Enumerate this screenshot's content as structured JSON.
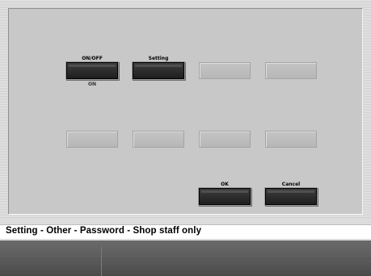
{
  "grid": {
    "row1": [
      {
        "label": "ON/OFF",
        "sub": "ON",
        "enabled": true
      },
      {
        "label": "Setting",
        "sub": "",
        "enabled": true
      },
      {
        "label": "",
        "sub": "",
        "enabled": false
      },
      {
        "label": "",
        "sub": "",
        "enabled": false
      }
    ],
    "row2": [
      {
        "label": "",
        "enabled": false
      },
      {
        "label": "",
        "enabled": false
      },
      {
        "label": "",
        "enabled": false
      },
      {
        "label": "",
        "enabled": false
      }
    ]
  },
  "actions": {
    "ok_label": "OK",
    "cancel_label": "Cancel"
  },
  "status": {
    "text": "Setting - Other - Password - Shop staff only"
  },
  "colors": {
    "panel": "#c8c8c8",
    "button_dark": "#2a2a2a",
    "button_blank": "#bdbdbd"
  }
}
